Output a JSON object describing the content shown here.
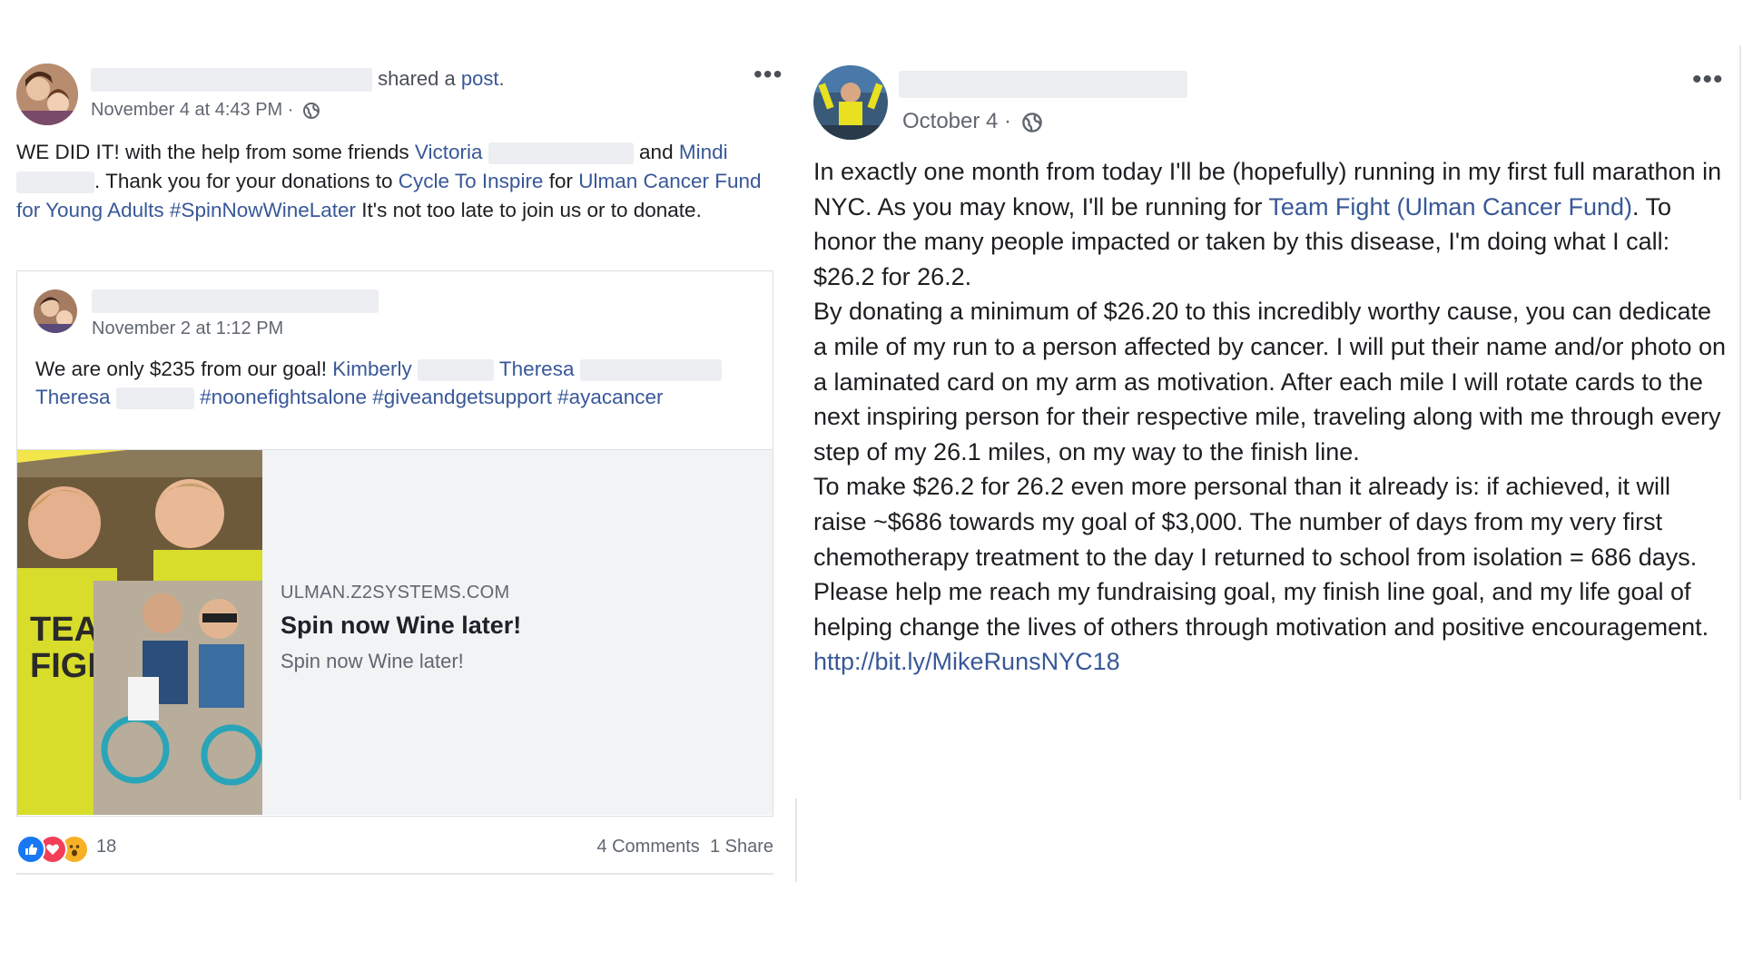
{
  "left_post": {
    "action_prefix": "shared a ",
    "action_link": "post",
    "action_suffix": ".",
    "timestamp": "November 4 at 4:43 PM · ",
    "body": {
      "t1": "WE DID IT! with the help from some friends ",
      "friend1": "Victoria",
      "t2": "and ",
      "friend2": "Mindi",
      "t3": ". Thank you for your donations to ",
      "link1": "Cycle To Inspire",
      "t4": " for ",
      "link2": "Ulman Cancer Fund for Young Adults",
      "t5": " ",
      "hashtag": "#SpinNowWineLater",
      "t6": " It's not too late to join us or to donate."
    },
    "shared": {
      "timestamp": "November 2 at 1:12 PM",
      "t1": "We are only $235 from our goal! ",
      "tag1": "Kimberly",
      "tag2": "Theresa",
      "tag3": "Theresa",
      "hashtags": "#noonefightsalone #giveandgetsupport #ayacancer",
      "preview": {
        "domain": "ULMAN.Z2SYSTEMS.COM",
        "title": "Spin now Wine later!",
        "description": "Spin now Wine later!"
      }
    },
    "footer": {
      "reaction_count": "18",
      "comments": "4 Comments",
      "shares": "1 Share"
    }
  },
  "right_post": {
    "timestamp": "October 4 · ",
    "body": {
      "p1a": "In exactly one month from today I'll be (hopefully) running in my first full marathon in NYC. As you may know, I'll be running for ",
      "p1link": "Team Fight (Ulman Cancer Fund)",
      "p1b": ". To honor the many people impacted or taken by this disease, I'm doing what I call: $26.2 for 26.2.",
      "p2": "By donating a minimum of $26.20 to this incredibly worthy cause, you can dedicate a mile of my run to a person affected by cancer. I will put their name and/or photo on a laminated card on my arm as motivation. After each mile I will rotate cards to the next inspiring person for their respective mile, traveling along with me through every step of my 26.1 miles, on my way to the finish line.",
      "p3": "To make $26.2 for 26.2 even more personal than it already is: if achieved, it will raise ~$686 towards my goal of $3,000. The number of days from my very first chemotherapy treatment to the day I returned to school from isolation = 686 days.",
      "p4": "Please help me reach my fundraising goal, my finish line goal, and my life goal of helping change the lives of others through motivation and positive encouragement.",
      "url": "http://bit.ly/MikeRunsNYC18"
    }
  },
  "colors": {
    "link": "#385898",
    "text": "#1c1e21",
    "meta": "#616770",
    "like": "#1877f2",
    "love": "#f33e58",
    "wow": "#f7b125"
  },
  "icons": [
    "more-options-icon",
    "globe-icon",
    "like-reaction-icon",
    "love-reaction-icon",
    "wow-reaction-icon"
  ]
}
